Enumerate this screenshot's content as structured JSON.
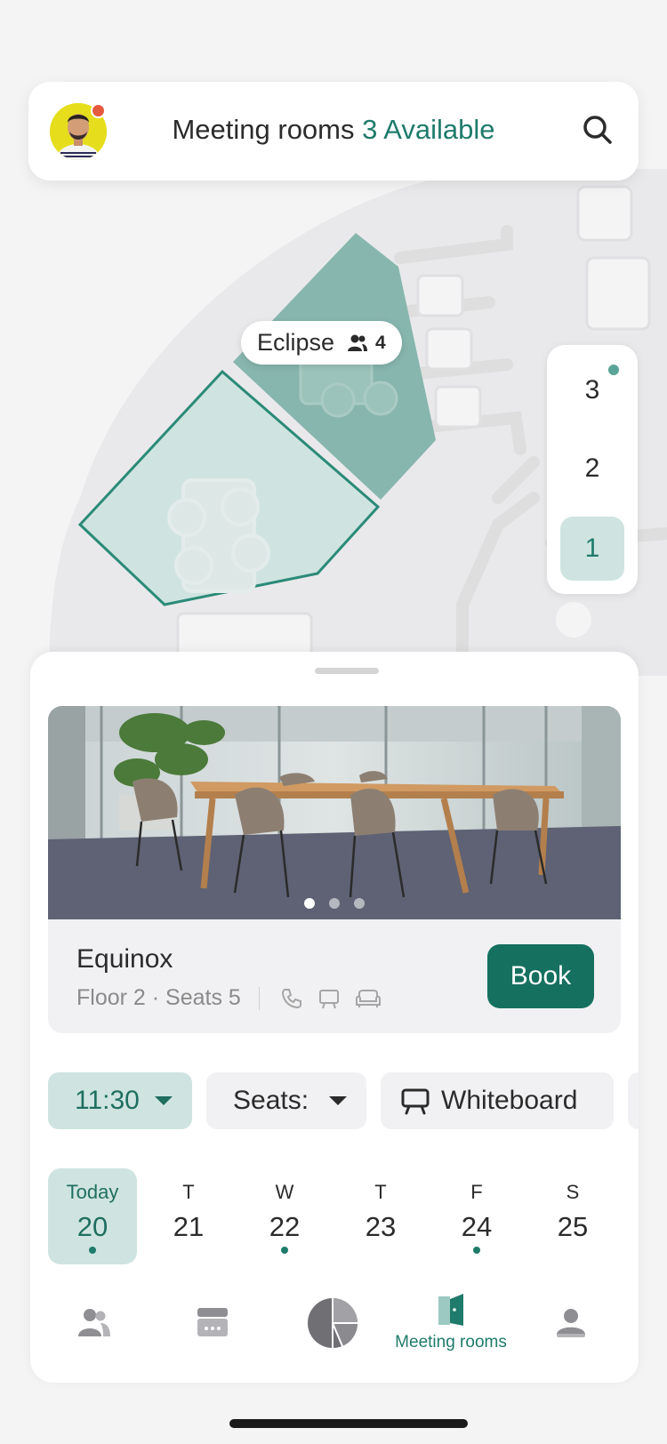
{
  "header": {
    "title": "Meeting rooms",
    "available": "3 Available",
    "search_icon": "search-icon",
    "avatar_status_color": "#e55a3d"
  },
  "map": {
    "room_label": "Eclipse",
    "room_seats": "4",
    "floors": [
      "3",
      "2",
      "1"
    ],
    "active_floor": "1",
    "floor_with_update": "3"
  },
  "room": {
    "name": "Equinox",
    "floor": "Floor 2",
    "seats": "Seats 5",
    "amenities": [
      "phone-icon",
      "whiteboard-icon",
      "lounge-icon"
    ],
    "book_label": "Book",
    "photo_count": 3,
    "photo_index": 1
  },
  "filters": {
    "time": "11:30",
    "seats": "Seats:",
    "whiteboard": "Whiteboard"
  },
  "dates": [
    {
      "dow": "Today",
      "num": "20",
      "event": true,
      "selected": true
    },
    {
      "dow": "T",
      "num": "21",
      "event": false
    },
    {
      "dow": "W",
      "num": "22",
      "event": true
    },
    {
      "dow": "T",
      "num": "23",
      "event": false
    },
    {
      "dow": "F",
      "num": "24",
      "event": true
    },
    {
      "dow": "S",
      "num": "25",
      "event": false
    }
  ],
  "nav": {
    "items": [
      "people-icon",
      "calendar-icon",
      "dashboard-icon",
      "door-icon",
      "profile-icon"
    ],
    "active_label": "Meeting rooms"
  },
  "colors": {
    "accent": "#1f7b6b",
    "accent_light": "#cfe4e0",
    "button": "#16705f"
  }
}
